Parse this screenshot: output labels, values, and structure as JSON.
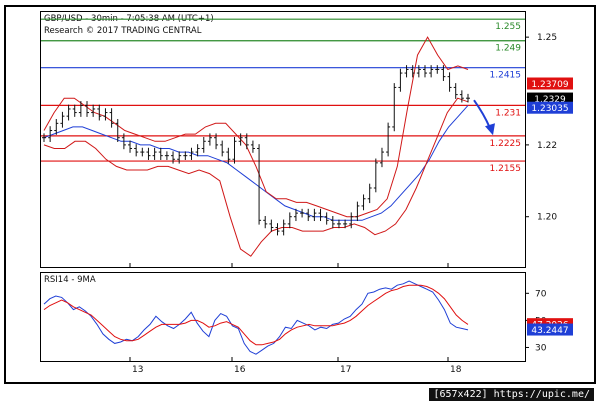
{
  "header": {
    "line1": "GBP/USD - 30min - 7:05:38 AM (UTC+1)",
    "line2": "Research © 2017 TRADING CENTRAL"
  },
  "rsi_header": "RSI14 - 9MA",
  "watermark": "[657x422] https://upic.me/",
  "colors": {
    "resistance_green": "#2a8a2a",
    "pivot_blue": "#1f3fd6",
    "support_red": "#e01010",
    "bollinger": "#d01818",
    "ma_blue": "#1f3fd6",
    "candle": "#111111",
    "arrow": "#1f3fd6"
  },
  "chart_data": [
    {
      "type": "candlestick",
      "symbol": "GBP/USD",
      "timeframe": "30min",
      "x_ticks": [
        "13",
        "16",
        "17",
        "18"
      ],
      "y_ticks": [
        1.2,
        1.22,
        1.25
      ],
      "ylim": [
        1.186,
        1.257
      ],
      "levels": [
        {
          "value": 1.255,
          "label": "1.255",
          "role": "resistance"
        },
        {
          "value": 1.249,
          "label": "1.249",
          "role": "resistance"
        },
        {
          "value": 1.2415,
          "label": "1.2415",
          "role": "pivot"
        },
        {
          "value": 1.231,
          "label": "1.231",
          "role": "support"
        },
        {
          "value": 1.2225,
          "label": "1.2225",
          "role": "support"
        },
        {
          "value": 1.2155,
          "label": "1.2155",
          "role": "support"
        }
      ],
      "price_badges": [
        {
          "value": 1.23709,
          "label": "1.23709",
          "color": "#e01010"
        },
        {
          "value": 1.2329,
          "label": "1.2329",
          "color": "#000000"
        },
        {
          "value": 1.23035,
          "label": "1.23035",
          "color": "#1f3fd6"
        }
      ],
      "series": [
        {
          "kind": "close",
          "values": [
            1.222,
            1.224,
            1.226,
            1.228,
            1.23,
            1.229,
            1.231,
            1.229,
            1.23,
            1.228,
            1.229,
            1.226,
            1.222,
            1.22,
            1.219,
            1.218,
            1.218,
            1.217,
            1.218,
            1.217,
            1.217,
            1.216,
            1.217,
            1.217,
            1.218,
            1.219,
            1.221,
            1.222,
            1.22,
            1.218,
            1.216,
            1.221,
            1.222,
            1.22,
            1.219,
            1.199,
            1.198,
            1.197,
            1.196,
            1.198,
            1.2,
            1.201,
            1.201,
            1.2,
            1.201,
            1.2,
            1.199,
            1.198,
            1.198,
            1.198,
            1.2,
            1.203,
            1.205,
            1.208,
            1.215,
            1.218,
            1.225,
            1.236,
            1.24,
            1.241,
            1.24,
            1.241,
            1.24,
            1.241,
            1.241,
            1.239,
            1.236,
            1.234,
            1.233,
            1.233
          ]
        },
        {
          "kind": "moving-average",
          "values": [
            1.222,
            1.223,
            1.224,
            1.225,
            1.225,
            1.224,
            1.223,
            1.222,
            1.221,
            1.221,
            1.22,
            1.22,
            1.219,
            1.219,
            1.218,
            1.218,
            1.217,
            1.217,
            1.216,
            1.215,
            1.213,
            1.211,
            1.209,
            1.207,
            1.205,
            1.203,
            1.202,
            1.201,
            1.2,
            1.2,
            1.199,
            1.199,
            1.199,
            1.199,
            1.2,
            1.201,
            1.203,
            1.206,
            1.209,
            1.212,
            1.216,
            1.221,
            1.225,
            1.228,
            1.231
          ]
        },
        {
          "kind": "bollinger-upper",
          "values": [
            1.224,
            1.229,
            1.233,
            1.233,
            1.231,
            1.229,
            1.228,
            1.226,
            1.224,
            1.223,
            1.222,
            1.221,
            1.221,
            1.222,
            1.223,
            1.223,
            1.225,
            1.226,
            1.226,
            1.223,
            1.22,
            1.214,
            1.207,
            1.205,
            1.205,
            1.204,
            1.204,
            1.203,
            1.202,
            1.201,
            1.2,
            1.2,
            1.201,
            1.202,
            1.205,
            1.214,
            1.23,
            1.245,
            1.25,
            1.245,
            1.241,
            1.242,
            1.241
          ]
        },
        {
          "kind": "bollinger-lower",
          "values": [
            1.22,
            1.219,
            1.219,
            1.221,
            1.221,
            1.219,
            1.216,
            1.214,
            1.213,
            1.213,
            1.213,
            1.214,
            1.214,
            1.213,
            1.212,
            1.213,
            1.212,
            1.21,
            1.2,
            1.191,
            1.189,
            1.193,
            1.196,
            1.197,
            1.197,
            1.196,
            1.196,
            1.196,
            1.197,
            1.197,
            1.198,
            1.197,
            1.195,
            1.196,
            1.198,
            1.202,
            1.208,
            1.215,
            1.222,
            1.229,
            1.233,
            1.232
          ]
        }
      ],
      "annotations": [
        {
          "type": "arrow",
          "direction": "down",
          "color": "#1f3fd6"
        }
      ]
    },
    {
      "type": "line",
      "title": "RSI14 - 9MA",
      "y_ticks": [
        30,
        50,
        70
      ],
      "ylim": [
        20,
        85
      ],
      "x_ticks": [
        "13",
        "16",
        "17",
        "18"
      ],
      "badges": [
        {
          "value": 47.2026,
          "label": "47.2026",
          "color": "#e01010"
        },
        {
          "value": 43.2447,
          "label": "43.2447",
          "color": "#1f3fd6"
        }
      ],
      "series": [
        {
          "kind": "rsi",
          "color": "#1f3fd6",
          "values": [
            62,
            66,
            68,
            67,
            63,
            58,
            60,
            57,
            53,
            47,
            40,
            36,
            33,
            34,
            36,
            35,
            38,
            43,
            47,
            53,
            49,
            46,
            44,
            47,
            51,
            56,
            48,
            42,
            38,
            50,
            55,
            53,
            46,
            44,
            33,
            27,
            25,
            28,
            31,
            33,
            38,
            45,
            44,
            50,
            48,
            46,
            43,
            45,
            44,
            47,
            48,
            51,
            53,
            58,
            62,
            70,
            71,
            73,
            74,
            73,
            76,
            77,
            79,
            77,
            75,
            73,
            71,
            65,
            58,
            48,
            45,
            44,
            43
          ]
        },
        {
          "kind": "rsi-ma",
          "color": "#e01010",
          "values": [
            58,
            61,
            63,
            65,
            63,
            60,
            58,
            56,
            54,
            50,
            46,
            42,
            38,
            36,
            35,
            35,
            36,
            39,
            42,
            45,
            47,
            47,
            47,
            47,
            48,
            50,
            50,
            48,
            45,
            46,
            48,
            49,
            47,
            45,
            40,
            35,
            32,
            32,
            33,
            34,
            36,
            40,
            43,
            45,
            46,
            47,
            46,
            46,
            46,
            46,
            47,
            48,
            50,
            53,
            57,
            61,
            64,
            67,
            70,
            72,
            73,
            75,
            76,
            76,
            76,
            75,
            73,
            70,
            66,
            60,
            54,
            50,
            47
          ]
        }
      ]
    }
  ]
}
